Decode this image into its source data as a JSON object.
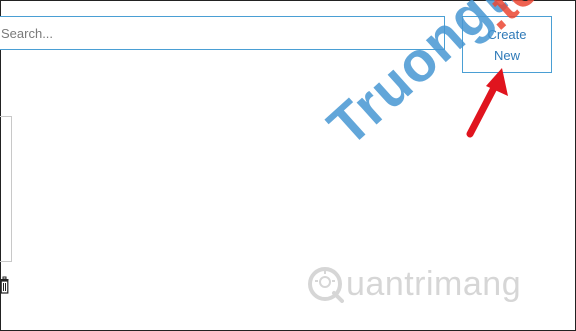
{
  "search": {
    "placeholder": "Search..."
  },
  "toolbar": {
    "create_label_line1": "Create",
    "create_label_line2": "New"
  },
  "watermark": {
    "site_text": "Truongtin",
    "site_suffix": ".top",
    "brand_text": "uantrimang"
  },
  "colors": {
    "accent": "#4a9fd4",
    "button_text": "#2f7ab8",
    "arrow": "#e0141e"
  },
  "icons": {
    "trash": "trash-icon",
    "arrow": "red-arrow-annotation"
  }
}
